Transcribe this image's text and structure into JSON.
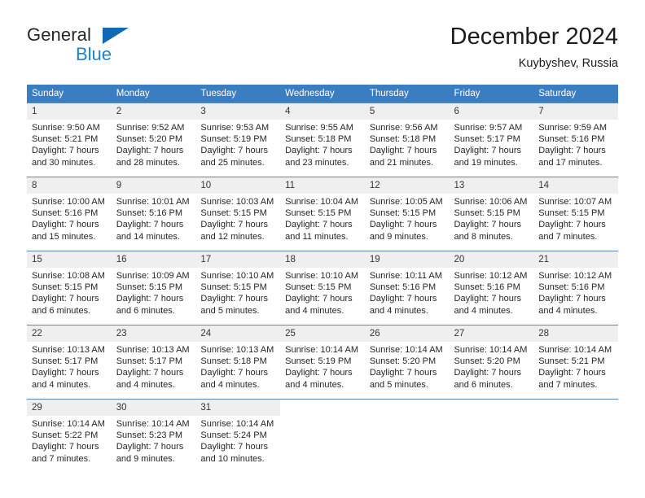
{
  "brand": {
    "name_top": "General",
    "name_bottom": "Blue",
    "triangle_color": "#1268b3",
    "blue_color": "#1884d1"
  },
  "header": {
    "title": "December 2024",
    "location": "Kuybyshev, Russia"
  },
  "theme": {
    "header_row_background": "#3b7dc1",
    "header_row_text": "#ffffff",
    "daynum_background": "#efefef",
    "cell_border": "#5b87b6"
  },
  "weekday_headers": [
    "Sunday",
    "Monday",
    "Tuesday",
    "Wednesday",
    "Thursday",
    "Friday",
    "Saturday"
  ],
  "labels": {
    "sunrise_prefix": "Sunrise:",
    "sunset_prefix": "Sunset:",
    "daylight_prefix": "Daylight:"
  },
  "weeks": [
    [
      {
        "day": "1",
        "sunrise": "Sunrise: 9:50 AM",
        "sunset": "Sunset: 5:21 PM",
        "daylight_line1": "Daylight: 7 hours",
        "daylight_line2": "and 30 minutes."
      },
      {
        "day": "2",
        "sunrise": "Sunrise: 9:52 AM",
        "sunset": "Sunset: 5:20 PM",
        "daylight_line1": "Daylight: 7 hours",
        "daylight_line2": "and 28 minutes."
      },
      {
        "day": "3",
        "sunrise": "Sunrise: 9:53 AM",
        "sunset": "Sunset: 5:19 PM",
        "daylight_line1": "Daylight: 7 hours",
        "daylight_line2": "and 25 minutes."
      },
      {
        "day": "4",
        "sunrise": "Sunrise: 9:55 AM",
        "sunset": "Sunset: 5:18 PM",
        "daylight_line1": "Daylight: 7 hours",
        "daylight_line2": "and 23 minutes."
      },
      {
        "day": "5",
        "sunrise": "Sunrise: 9:56 AM",
        "sunset": "Sunset: 5:18 PM",
        "daylight_line1": "Daylight: 7 hours",
        "daylight_line2": "and 21 minutes."
      },
      {
        "day": "6",
        "sunrise": "Sunrise: 9:57 AM",
        "sunset": "Sunset: 5:17 PM",
        "daylight_line1": "Daylight: 7 hours",
        "daylight_line2": "and 19 minutes."
      },
      {
        "day": "7",
        "sunrise": "Sunrise: 9:59 AM",
        "sunset": "Sunset: 5:16 PM",
        "daylight_line1": "Daylight: 7 hours",
        "daylight_line2": "and 17 minutes."
      }
    ],
    [
      {
        "day": "8",
        "sunrise": "Sunrise: 10:00 AM",
        "sunset": "Sunset: 5:16 PM",
        "daylight_line1": "Daylight: 7 hours",
        "daylight_line2": "and 15 minutes."
      },
      {
        "day": "9",
        "sunrise": "Sunrise: 10:01 AM",
        "sunset": "Sunset: 5:16 PM",
        "daylight_line1": "Daylight: 7 hours",
        "daylight_line2": "and 14 minutes."
      },
      {
        "day": "10",
        "sunrise": "Sunrise: 10:03 AM",
        "sunset": "Sunset: 5:15 PM",
        "daylight_line1": "Daylight: 7 hours",
        "daylight_line2": "and 12 minutes."
      },
      {
        "day": "11",
        "sunrise": "Sunrise: 10:04 AM",
        "sunset": "Sunset: 5:15 PM",
        "daylight_line1": "Daylight: 7 hours",
        "daylight_line2": "and 11 minutes."
      },
      {
        "day": "12",
        "sunrise": "Sunrise: 10:05 AM",
        "sunset": "Sunset: 5:15 PM",
        "daylight_line1": "Daylight: 7 hours",
        "daylight_line2": "and 9 minutes."
      },
      {
        "day": "13",
        "sunrise": "Sunrise: 10:06 AM",
        "sunset": "Sunset: 5:15 PM",
        "daylight_line1": "Daylight: 7 hours",
        "daylight_line2": "and 8 minutes."
      },
      {
        "day": "14",
        "sunrise": "Sunrise: 10:07 AM",
        "sunset": "Sunset: 5:15 PM",
        "daylight_line1": "Daylight: 7 hours",
        "daylight_line2": "and 7 minutes."
      }
    ],
    [
      {
        "day": "15",
        "sunrise": "Sunrise: 10:08 AM",
        "sunset": "Sunset: 5:15 PM",
        "daylight_line1": "Daylight: 7 hours",
        "daylight_line2": "and 6 minutes."
      },
      {
        "day": "16",
        "sunrise": "Sunrise: 10:09 AM",
        "sunset": "Sunset: 5:15 PM",
        "daylight_line1": "Daylight: 7 hours",
        "daylight_line2": "and 6 minutes."
      },
      {
        "day": "17",
        "sunrise": "Sunrise: 10:10 AM",
        "sunset": "Sunset: 5:15 PM",
        "daylight_line1": "Daylight: 7 hours",
        "daylight_line2": "and 5 minutes."
      },
      {
        "day": "18",
        "sunrise": "Sunrise: 10:10 AM",
        "sunset": "Sunset: 5:15 PM",
        "daylight_line1": "Daylight: 7 hours",
        "daylight_line2": "and 4 minutes."
      },
      {
        "day": "19",
        "sunrise": "Sunrise: 10:11 AM",
        "sunset": "Sunset: 5:16 PM",
        "daylight_line1": "Daylight: 7 hours",
        "daylight_line2": "and 4 minutes."
      },
      {
        "day": "20",
        "sunrise": "Sunrise: 10:12 AM",
        "sunset": "Sunset: 5:16 PM",
        "daylight_line1": "Daylight: 7 hours",
        "daylight_line2": "and 4 minutes."
      },
      {
        "day": "21",
        "sunrise": "Sunrise: 10:12 AM",
        "sunset": "Sunset: 5:16 PM",
        "daylight_line1": "Daylight: 7 hours",
        "daylight_line2": "and 4 minutes."
      }
    ],
    [
      {
        "day": "22",
        "sunrise": "Sunrise: 10:13 AM",
        "sunset": "Sunset: 5:17 PM",
        "daylight_line1": "Daylight: 7 hours",
        "daylight_line2": "and 4 minutes."
      },
      {
        "day": "23",
        "sunrise": "Sunrise: 10:13 AM",
        "sunset": "Sunset: 5:17 PM",
        "daylight_line1": "Daylight: 7 hours",
        "daylight_line2": "and 4 minutes."
      },
      {
        "day": "24",
        "sunrise": "Sunrise: 10:13 AM",
        "sunset": "Sunset: 5:18 PM",
        "daylight_line1": "Daylight: 7 hours",
        "daylight_line2": "and 4 minutes."
      },
      {
        "day": "25",
        "sunrise": "Sunrise: 10:14 AM",
        "sunset": "Sunset: 5:19 PM",
        "daylight_line1": "Daylight: 7 hours",
        "daylight_line2": "and 4 minutes."
      },
      {
        "day": "26",
        "sunrise": "Sunrise: 10:14 AM",
        "sunset": "Sunset: 5:20 PM",
        "daylight_line1": "Daylight: 7 hours",
        "daylight_line2": "and 5 minutes."
      },
      {
        "day": "27",
        "sunrise": "Sunrise: 10:14 AM",
        "sunset": "Sunset: 5:20 PM",
        "daylight_line1": "Daylight: 7 hours",
        "daylight_line2": "and 6 minutes."
      },
      {
        "day": "28",
        "sunrise": "Sunrise: 10:14 AM",
        "sunset": "Sunset: 5:21 PM",
        "daylight_line1": "Daylight: 7 hours",
        "daylight_line2": "and 7 minutes."
      }
    ],
    [
      {
        "day": "29",
        "sunrise": "Sunrise: 10:14 AM",
        "sunset": "Sunset: 5:22 PM",
        "daylight_line1": "Daylight: 7 hours",
        "daylight_line2": "and 7 minutes."
      },
      {
        "day": "30",
        "sunrise": "Sunrise: 10:14 AM",
        "sunset": "Sunset: 5:23 PM",
        "daylight_line1": "Daylight: 7 hours",
        "daylight_line2": "and 9 minutes."
      },
      {
        "day": "31",
        "sunrise": "Sunrise: 10:14 AM",
        "sunset": "Sunset: 5:24 PM",
        "daylight_line1": "Daylight: 7 hours",
        "daylight_line2": "and 10 minutes."
      },
      {
        "day": "",
        "sunrise": "",
        "sunset": "",
        "daylight_line1": "",
        "daylight_line2": ""
      },
      {
        "day": "",
        "sunrise": "",
        "sunset": "",
        "daylight_line1": "",
        "daylight_line2": ""
      },
      {
        "day": "",
        "sunrise": "",
        "sunset": "",
        "daylight_line1": "",
        "daylight_line2": ""
      },
      {
        "day": "",
        "sunrise": "",
        "sunset": "",
        "daylight_line1": "",
        "daylight_line2": ""
      }
    ]
  ]
}
